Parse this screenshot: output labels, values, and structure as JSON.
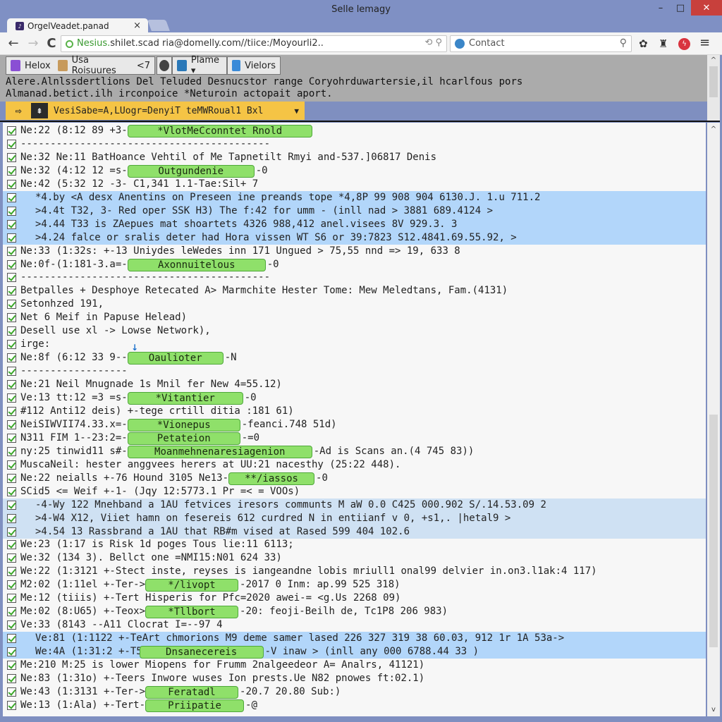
{
  "window": {
    "title": "Selle lemagy",
    "minimize": "–",
    "maximize": "□",
    "close": "✕"
  },
  "tab": {
    "label": "OrgelVeadet.panad",
    "close": "×"
  },
  "nav": {
    "back": "←",
    "forward": "→",
    "reload": "C",
    "url_host": "Nesius.",
    "url_rest": "shilet.scad ria@domelly.com//tiice:/Moyourli2..",
    "url_icons": "⟲ ⚲",
    "search_value": "Contact",
    "search_icon": "⚲"
  },
  "toolbar_icons": {
    "star": "✿",
    "castle": "♜",
    "red_badge": "ϟ",
    "menu": "≡"
  },
  "bookmarks": [
    {
      "label": "Helox",
      "icon_color": "#8a4fd4"
    },
    {
      "label": "Usa Roisuures",
      "icon_color": "#c79a5c",
      "suffix": "<7"
    },
    {
      "label": "",
      "icon_color": "#444444"
    },
    {
      "label": "Plame ▾",
      "icon_color": "#2a78b8"
    },
    {
      "label": "Vielors",
      "icon_color": "#3a8ad8"
    }
  ],
  "notice": {
    "line1": "Alere.Alnlssdertlions Del Teluded Desnucstor range Coryohrduwartersie,il hcarlfous pors",
    "line2": "Almanad.betict.ilh irconpoice *Neturoin actopait aport."
  },
  "filter_bar": {
    "arrow": "⇨",
    "tree": "⇞",
    "value": "VesiSabe=A,LUogr=DenyiT teMWRoual1 Bxl",
    "dropdown": "▼"
  },
  "log_rows": [
    {
      "text": "Ne:22 (8:12 89 +3-",
      "badge": "*VlotMeCconntet Rnold",
      "after": ""
    },
    {
      "text": "------------------------------------------",
      "badge": "",
      "after": ""
    },
    {
      "text": "Ne:32 Ne:11 BatHoance Vehtil of Me Tapnetilt Rmyi and-537.]06817 Denis",
      "badge": "",
      "after": ""
    },
    {
      "text": "Ne:32 (4:12 12 =s-",
      "badge": "Outgundenie",
      "after": "-0"
    },
    {
      "text": "Ne:42 (5:32 12 -3- C1,341 1.1-Tae:Sil+ 7",
      "badge": "",
      "after": ""
    },
    {
      "text": "*4.by <A desx Anentins on Preseen ine preands tope *4,8P 99 908 904 6130.J. 1.u 711.2",
      "badge": "",
      "after": "",
      "hl": 1
    },
    {
      "text": ">4.4t T32, 3- Red oper SSK H3) The f:42 for umm - (inll nad > 3881 689.4124 >",
      "badge": "",
      "after": "",
      "hl": 1
    },
    {
      "text": ">4.44 T33 is ZAepues mat shoartets 4326 988,412 anel.visees 8V 929.3. 3",
      "badge": "",
      "after": "",
      "hl": 1
    },
    {
      "text": ">4.24 falce or sralis deter had Hora vissen WT S6 or 39:7823 S12.4841.69.55.92, >",
      "badge": "",
      "after": "",
      "hl": 1
    },
    {
      "text": "Ne:33 (1:32s: +-13 Uniydes leWedes inn 171 Ungued > 75,55 nnd => 19, 633 8",
      "badge": "",
      "after": ""
    },
    {
      "text": "Ne:0f-(1:181-3.a=-",
      "badge": "Axonnuitelous",
      "after": "-0"
    },
    {
      "text": "------------------------------------------",
      "badge": "",
      "after": ""
    },
    {
      "text": "Betpalles + Desphoye Retecated A> Marmchite Hester Tome: Mew Meledtans, Fam.(4131)",
      "badge": "",
      "after": ""
    },
    {
      "text": "Setonhzed 191,",
      "badge": "",
      "after": ""
    },
    {
      "text": "Net 6 Meif in Papuse Helead)",
      "badge": "",
      "after": ""
    },
    {
      "text": "Desell use xl -> Lowse Network),",
      "badge": "",
      "after": ""
    },
    {
      "text": "irge:",
      "badge": "",
      "after": ""
    },
    {
      "text": "Ne:8f (6:12 33 9--",
      "badge": "Oaulioter",
      "after": "-N"
    },
    {
      "text": "------------------",
      "badge": "",
      "after": ""
    },
    {
      "text": "Ne:21 Neil Mnugnade 1s Mnil fer New 4=55.12)",
      "badge": "",
      "after": ""
    },
    {
      "text": "Ve:13 tt:12 =3 =s-",
      "badge": "*Vitantier",
      "after": "-0"
    },
    {
      "text": "#112 Anti12 deis) +-tege crtill ditia :181 61)",
      "badge": "",
      "after": ""
    },
    {
      "text": "NeiSIWVII74.33.x=-",
      "badge": "*Vionepus",
      "after": "-feanci.748 51d)"
    },
    {
      "text": "N311 FIM 1--23:2=-",
      "badge": "Petateion",
      "after": "-=0"
    },
    {
      "text": "ny:25 tinwid11 s#-",
      "badge": "Moanmehnenaresiagenion",
      "after": "-Ad is Scans an.(4 745 83))"
    },
    {
      "text": "MuscaNeil: hester anggvees herers at UU:21 nacesthy (25:22 448).",
      "badge": "",
      "after": ""
    },
    {
      "text": "Ne:22 neialls +-76 Hound 3105 Ne13-",
      "badge": "**/iassos",
      "after": "-0"
    },
    {
      "text": "SCid5 <= Weif +-1- (Jqy 12:5773.1 Pr =< = VOOs)",
      "badge": "",
      "after": ""
    },
    {
      "text": "-4-Wy 122 Mnehband a 1AU fetvices iresors communts M aW 0.0 C425 000.902 S/.14.53.09 2",
      "badge": "",
      "after": "",
      "hl": 2
    },
    {
      "text": ">4-W4 X12, Viiet hamn on fesereis 612 curdred N in entiianf v 0, +s1,. |hetal9 >",
      "badge": "",
      "after": "",
      "hl": 2
    },
    {
      "text": ">4.54 13 Rassbrand a 1AU that RB#m vised at Rased 599 404 102.6",
      "badge": "",
      "after": "",
      "hl": 2
    },
    {
      "text": "We:23 (1:17 is Risk 1d poges Tous lie:11 6113;",
      "badge": "",
      "after": ""
    },
    {
      "text": "We:32 (134 3). Bellct one =NMI15:N01 624 33)",
      "badge": "",
      "after": ""
    },
    {
      "text": "We:22 (1:3121 +-Stect inste, reyses is iangeandne lobis mriull1 onal99 delvier in.on3.l1ak:4 117)",
      "badge": "",
      "after": ""
    },
    {
      "text": "M2:02 (1:11el +-Ter->",
      "badge": "*/livopt",
      "after": "-2017 0 Inm: ap.99 525 318)"
    },
    {
      "text": "Me:12 (tiiis) +-Tert Hisperis for Pfc=2020 awei-= <g.Us 2268 09)",
      "badge": "",
      "after": ""
    },
    {
      "text": "Me:02 (8:U65) +-Teox>",
      "badge": "*Tllbort",
      "after": "-20: feoji-Beilh de, Tc1P8 206 983)"
    },
    {
      "text": "Ve:33 (8143 --A11 Clocrat I=--97 4",
      "badge": "",
      "after": ""
    },
    {
      "text": "Ve:81 (1:1122 +-TeArt chmorions M9 deme samer lased 226 327 319 38 60.03, 912 1r 1A 53a->",
      "badge": "",
      "after": "",
      "hl": 1
    },
    {
      "text": "We:4A (1:31:2 +-T53-",
      "badge": "Dnsanecereis",
      "after": "-V inaw > (inll any 000 6788.44 33 )",
      "hl": 1
    },
    {
      "text": "Me:210 M:25 is lower Miopens for Frumm 2nalgeedeor A= Analrs, 41121)",
      "badge": "",
      "after": ""
    },
    {
      "text": "Ne:83 (1:31o) +-Teers Inwore wuses Ion prests.Ue N82 pnowes ft:02.1)",
      "badge": "",
      "after": ""
    },
    {
      "text": "We:43 (1:3131 +-Ter->",
      "badge": "Feratadl",
      "after": "-20.7 20.80 Sub:)"
    },
    {
      "text": "We:13 (1:Ala) +-Tert-",
      "badge": "Priipatie",
      "after": "-@"
    }
  ],
  "scrollbar": {
    "up": "^",
    "down": "v"
  }
}
